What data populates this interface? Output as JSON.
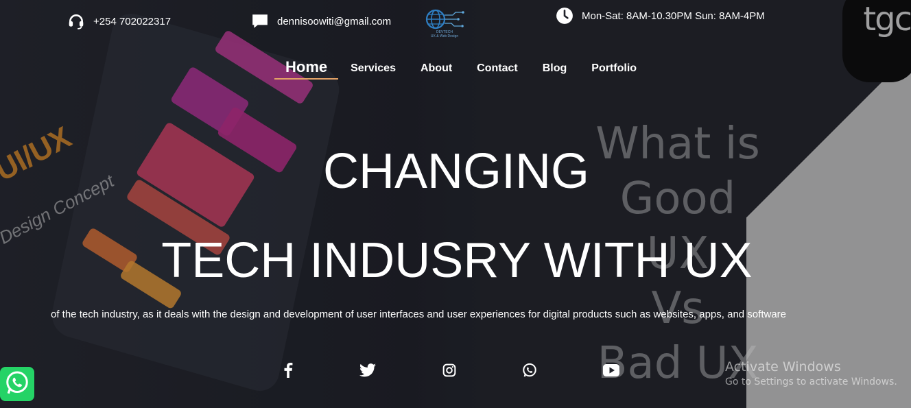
{
  "contact": {
    "phone": "+254 702022317",
    "email": "dennisoowiti@gmail.com",
    "hours": "Mon-Sat: 8AM-10.30PM Sun: 8AM-4PM"
  },
  "brand": {
    "logo_icon": "globe-circuit-icon",
    "caption_line1": "DEVTECH",
    "caption_line2": "UX & Web Design"
  },
  "nav": {
    "items": [
      {
        "label": "Home",
        "active": true
      },
      {
        "label": "Services"
      },
      {
        "label": "About"
      },
      {
        "label": "Contact"
      },
      {
        "label": "Blog"
      },
      {
        "label": "Portfolio"
      }
    ],
    "active_underline_color": "#e4a366"
  },
  "hero": {
    "headline_line1": "CHANGING",
    "headline_line2": "TECH INDUSRY WITH UX",
    "description": "of the tech industry, as it deals with the design and development of user interfaces and user experiences for digital products such as websites, apps, and software",
    "background_text": {
      "logo": "tgc",
      "good_ux": [
        "What is",
        "Good UX",
        "Vs",
        "Bad UX"
      ],
      "uiux": "UI/UX",
      "design_concept": "Design Concept"
    }
  },
  "social": [
    {
      "name": "facebook-icon"
    },
    {
      "name": "twitter-icon"
    },
    {
      "name": "instagram-icon"
    },
    {
      "name": "whatsapp-icon"
    },
    {
      "name": "youtube-icon"
    }
  ],
  "floating_whatsapp": {
    "icon": "whatsapp-icon",
    "color": "#25d366"
  },
  "os_overlay": {
    "title": "Activate Windows",
    "subtitle": "Go to Settings to activate Windows."
  }
}
